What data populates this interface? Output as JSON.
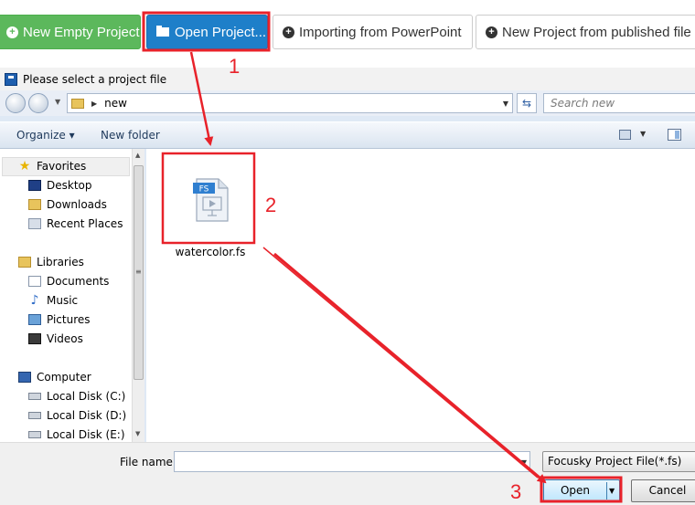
{
  "toolbar": {
    "new_empty_label": "New Empty Project",
    "open_project_label": "Open Project...",
    "import_ppt_label": "Importing from PowerPoint",
    "new_published_label": "New Project from published file"
  },
  "dialog": {
    "title": "Please select a project file",
    "address_path": "new",
    "search_placeholder": "Search new",
    "organize_label": "Organize ▾",
    "new_folder_label": "New folder"
  },
  "nav": {
    "favorites": "Favorites",
    "desktop": "Desktop",
    "downloads": "Downloads",
    "recent_places": "Recent Places",
    "libraries": "Libraries",
    "documents": "Documents",
    "music": "Music",
    "pictures": "Pictures",
    "videos": "Videos",
    "computer": "Computer",
    "disk_c": "Local Disk (C:)",
    "disk_d": "Local Disk (D:)",
    "disk_e": "Local Disk (E:)"
  },
  "file": {
    "name": "watercolor.fs",
    "badge": "FS"
  },
  "bottom": {
    "file_name_label": "File name:",
    "file_name_value": "",
    "file_type": "Focusky Project File(*.fs)",
    "open_label": "Open",
    "cancel_label": "Cancel"
  },
  "annotations": {
    "step1": "1",
    "step2": "2",
    "step3": "3",
    "color": "#e8222a"
  }
}
